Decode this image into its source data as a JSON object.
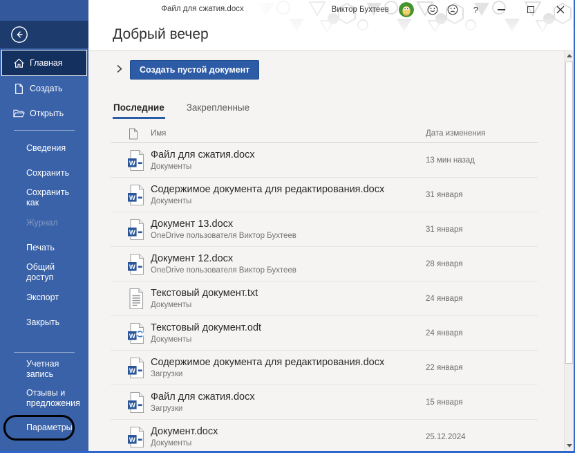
{
  "window": {
    "title": "Файл для сжатия.docx",
    "account": {
      "user_name": "Виктор Бухтеев",
      "help_label": "?"
    }
  },
  "sidebar": {
    "top_items": [
      {
        "id": "home",
        "label": "Главная",
        "icon": "home-icon",
        "selected": true
      },
      {
        "id": "create",
        "label": "Создать",
        "icon": "new-document-icon",
        "selected": false
      },
      {
        "id": "open",
        "label": "Открыть",
        "icon": "open-folder-icon",
        "selected": false
      }
    ],
    "mid_items": [
      {
        "id": "info",
        "label": "Сведения"
      },
      {
        "id": "save",
        "label": "Сохранить"
      },
      {
        "id": "save-as",
        "label": "Сохранить как"
      },
      {
        "id": "history",
        "label": "Журнал",
        "disabled": true
      },
      {
        "id": "print",
        "label": "Печать"
      },
      {
        "id": "share",
        "label": "Общий доступ"
      },
      {
        "id": "export",
        "label": "Экспорт"
      },
      {
        "id": "close",
        "label": "Закрыть"
      }
    ],
    "bottom_items": [
      {
        "id": "account",
        "label": "Учетная запись"
      },
      {
        "id": "feedback",
        "label": "Отзывы и предложения",
        "two_line": true
      },
      {
        "id": "options",
        "label": "Параметры",
        "annotated": true
      }
    ]
  },
  "main": {
    "greeting": "Добрый вечер",
    "create_button_label": "Создать пустой документ",
    "tabs": [
      {
        "id": "recent",
        "label": "Последние",
        "active": true
      },
      {
        "id": "pinned",
        "label": "Закрепленные",
        "active": false
      }
    ],
    "table": {
      "name_column": "Имя",
      "date_column": "Дата изменения",
      "rows": [
        {
          "icon": "word-docx-icon",
          "name": "Файл для сжатия.docx",
          "location": "Документы",
          "date": "13 мин назад"
        },
        {
          "icon": "word-docx-icon",
          "name": "Содержимое документа для редактирования.docx",
          "location": "Документы",
          "date": "31 января"
        },
        {
          "icon": "word-docx-icon",
          "name": "Документ 13.docx",
          "location": "OneDrive пользователя Виктор Бухтеев",
          "date": "31 января"
        },
        {
          "icon": "word-docx-icon",
          "name": "Документ 12.docx",
          "location": "OneDrive пользователя Виктор Бухтеев",
          "date": "28 января"
        },
        {
          "icon": "text-file-icon",
          "name": "Текстовый документ.txt",
          "location": "Документы",
          "date": "24 января"
        },
        {
          "icon": "word-odt-icon",
          "name": "Текстовый документ.odt",
          "location": "Документы",
          "date": "24 января"
        },
        {
          "icon": "word-docx-icon",
          "name": "Содержимое документа для редактирования.docx",
          "location": "Загрузки",
          "date": "22 января"
        },
        {
          "icon": "word-docx-icon",
          "name": "Файл для сжатия.docx",
          "location": "Загрузки",
          "date": "15 января"
        },
        {
          "icon": "word-docx-icon",
          "name": "Документ.docx",
          "location": "Документы",
          "date": "25.12.2024"
        }
      ]
    }
  },
  "colors": {
    "sidebar_blue": "#3a62a8",
    "sidebar_dark_band": "#1d3b6c",
    "selected_item_navy": "#14305f",
    "accent_button_blue": "#2d5ba6",
    "tab_underline_blue": "#2a5da8",
    "word_icon_blue": "#2b579a",
    "annotation_black": "#000000",
    "window_border_blue": "#3467c6"
  }
}
